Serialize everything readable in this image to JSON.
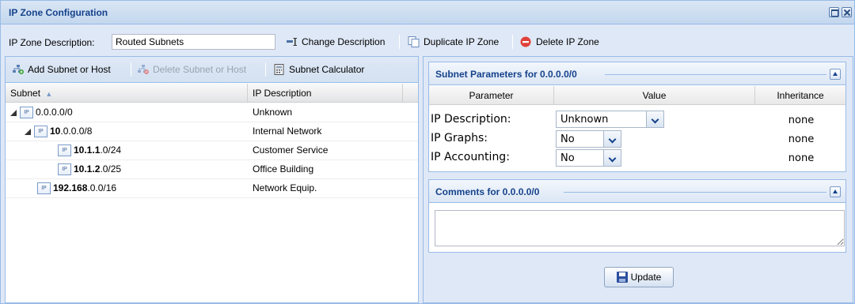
{
  "window": {
    "title": "IP Zone Configuration"
  },
  "toolbar": {
    "description_label": "IP Zone Description:",
    "description_value": "Routed Subnets",
    "change_description": "Change Description",
    "duplicate_zone": "Duplicate IP Zone",
    "delete_zone": "Delete IP Zone"
  },
  "left": {
    "add_subnet": "Add Subnet or Host",
    "delete_subnet": "Delete Subnet or Host",
    "subnet_calculator": "Subnet Calculator",
    "columns": {
      "subnet": "Subnet",
      "sort_indicator": "▲",
      "ip_description": "IP Description"
    },
    "rows": [
      {
        "bold": "",
        "rest": "0.0.0.0/0",
        "description": "Unknown"
      },
      {
        "bold": "10",
        "rest": ".0.0.0/8",
        "description": "Internal Network"
      },
      {
        "bold": "10.1.1",
        "rest": ".0/24",
        "description": "Customer Service"
      },
      {
        "bold": "10.1.2",
        "rest": ".0/25",
        "description": "Office Building"
      },
      {
        "bold": "192.168",
        "rest": ".0.0/16",
        "description": "Network Equip."
      }
    ],
    "icon_text": "IP"
  },
  "params": {
    "title": "Subnet Parameters for 0.0.0.0/0",
    "headers": {
      "parameter": "Parameter",
      "value": "Value",
      "inheritance": "Inheritance"
    },
    "rows": [
      {
        "label": "IP Description:",
        "value": "Unknown",
        "inheritance": "none"
      },
      {
        "label": "IP Graphs:",
        "value": "No",
        "inheritance": "none"
      },
      {
        "label": "IP Accounting:",
        "value": "No",
        "inheritance": "none"
      }
    ]
  },
  "comments": {
    "title": "Comments for 0.0.0.0/0",
    "value": ""
  },
  "update_button": "Update",
  "colors": {
    "accent": "#15428b",
    "panel_bg": "#dfe8f6",
    "border": "#99bbe8",
    "delete_red": "#e0413a"
  }
}
